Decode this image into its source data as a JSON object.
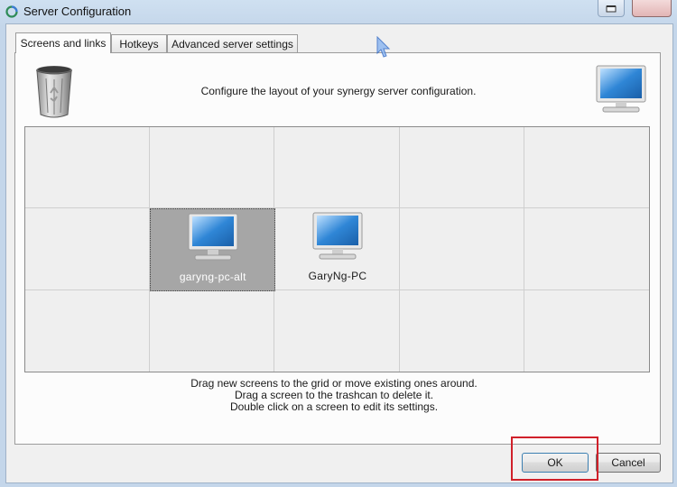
{
  "window": {
    "title": "Server Configuration",
    "icons": {
      "app": "synergy-icon",
      "restore": "restore-icon",
      "close": "close-icon"
    }
  },
  "tabs": [
    {
      "label": "Screens and links",
      "active": true
    },
    {
      "label": "Hotkeys",
      "active": false
    },
    {
      "label": "Advanced server settings",
      "active": false
    }
  ],
  "panel": {
    "header_text": "Configure the layout of your synergy server configuration.",
    "trash_icon": "trashcan-icon",
    "new_screen_icon": "monitor-icon"
  },
  "grid": {
    "rows": 3,
    "cols": 5,
    "screens": [
      {
        "name": "garyng-pc-alt",
        "row": 1,
        "col": 1,
        "selected": true
      },
      {
        "name": "GaryNg-PC",
        "row": 1,
        "col": 2,
        "selected": false
      }
    ]
  },
  "instructions": [
    "Drag new screens to the grid or move existing ones around.",
    "Drag a screen to the trashcan to delete it.",
    "Double click on a screen to edit its settings."
  ],
  "buttons": {
    "ok": "OK",
    "cancel": "Cancel"
  },
  "colors": {
    "highlight": "#d0202a",
    "selected_screen": "#a6a6a6",
    "monitor_blue": "#2f86d6"
  }
}
